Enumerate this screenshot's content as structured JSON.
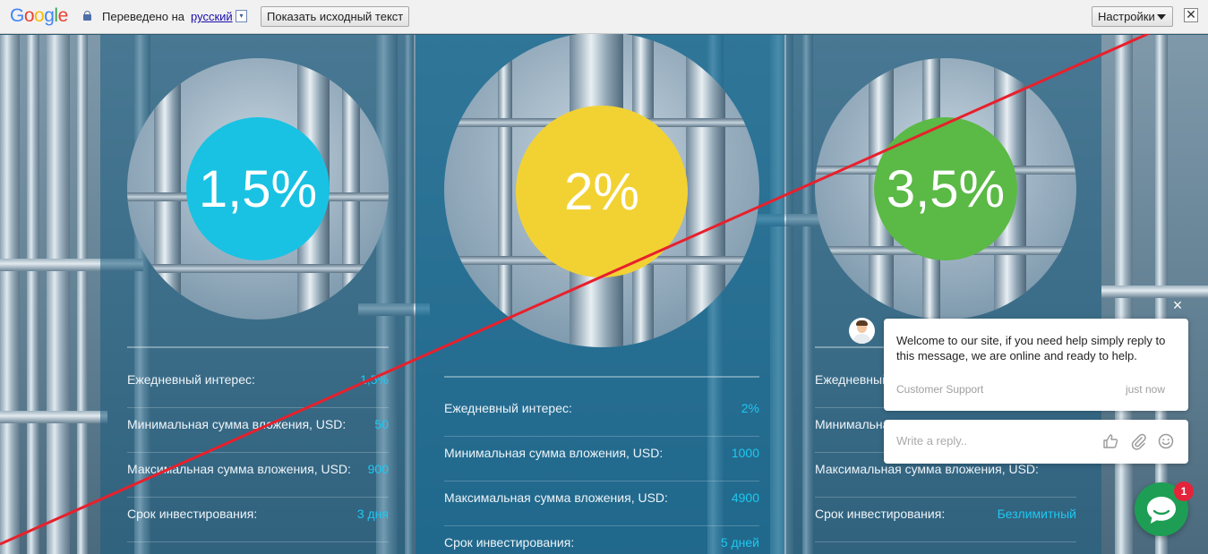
{
  "translate_bar": {
    "logo": "Google",
    "translated_to_label": "Переведено на",
    "language": "русский",
    "language_arrow": "▾",
    "show_original_label": "Показать исходный текст",
    "settings_label": "Настройки",
    "close_label": "✕"
  },
  "plans": [
    {
      "rate": "1,5%",
      "color": "#19c2e3",
      "rows": [
        {
          "label": "Ежедневный интерес:",
          "value": "1,5%"
        },
        {
          "label": "Минимальная сумма вложения, USD:",
          "value": "50"
        },
        {
          "label": "Максимальная сумма вложения, USD:",
          "value": "900"
        },
        {
          "label": "Срок инвестирования:",
          "value": "3 дня"
        }
      ]
    },
    {
      "rate": "2%",
      "color": "#f2d233",
      "rows": [
        {
          "label": "Ежедневный интерес:",
          "value": "2%"
        },
        {
          "label": "Минимальная сумма вложения, USD:",
          "value": "1000"
        },
        {
          "label": "Максимальная сумма вложения, USD:",
          "value": "4900"
        },
        {
          "label": "Срок инвестирования:",
          "value": "5 дней"
        }
      ]
    },
    {
      "rate": "3,5%",
      "color": "#5bb946",
      "rows": [
        {
          "label": "Ежедневный интерес:",
          "value": ""
        },
        {
          "label": "Минимальная сумма вложения, USD:",
          "value": ""
        },
        {
          "label": "Максимальная сумма вложения, USD:",
          "value": ""
        },
        {
          "label": "Срок инвестирования:",
          "value": "Безлимитный"
        }
      ]
    }
  ],
  "chat": {
    "close_label": "×",
    "message": "Welcome to our site, if you need help simply reply to this message, we are online and ready to help.",
    "sender": "Customer Support",
    "time": "just now",
    "reply_placeholder": "Write a reply..",
    "badge_count": "1",
    "icons": [
      "thumbs-up-icon",
      "paperclip-icon",
      "emoji-icon",
      "chat-bubble-icon",
      "user-avatar"
    ]
  }
}
